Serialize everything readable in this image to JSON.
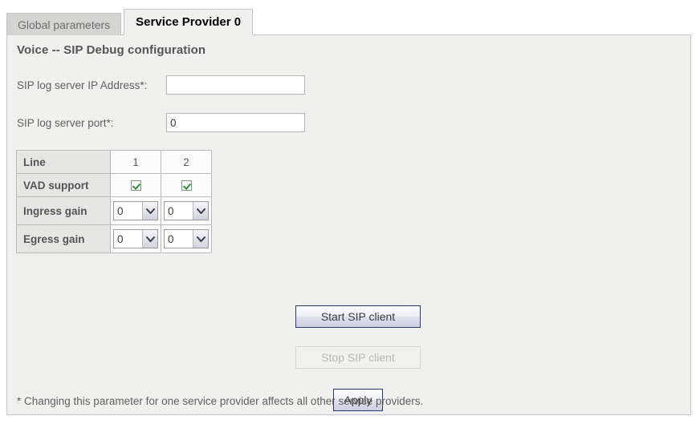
{
  "tabs": [
    {
      "label": "Global parameters",
      "active": false
    },
    {
      "label": "Service Provider 0",
      "active": true
    }
  ],
  "page": {
    "title": "Voice -- SIP Debug configuration",
    "footnote": "* Changing this parameter for one service provider affects all other service providers."
  },
  "fields": {
    "sip_log_server_ip": {
      "label": "SIP log server IP Address*:",
      "value": "",
      "placeholder": ""
    },
    "sip_log_server_port": {
      "label": "SIP log server port*:",
      "value": "0",
      "placeholder": ""
    }
  },
  "line_table": {
    "row_headers": [
      "Line",
      "VAD support",
      "Ingress gain",
      "Egress gain"
    ],
    "columns": [
      "1",
      "2"
    ],
    "vad_support": [
      true,
      true
    ],
    "ingress_gain": [
      "0",
      "0"
    ],
    "egress_gain": [
      "0",
      "0"
    ],
    "gain_options": [
      "0"
    ]
  },
  "buttons": {
    "start_sip_client": {
      "label": "Start SIP client",
      "enabled": true
    },
    "stop_sip_client": {
      "label": "Stop SIP client",
      "enabled": false
    },
    "apply": {
      "label": "Apply",
      "enabled": true
    }
  },
  "colors": {
    "panel_background": "#f0f0ee",
    "panel_border": "#c4c4c2",
    "inactive_tab": "#d4d4d2",
    "active_tab": "#f0f0ee",
    "button_focus_border": "#2b3a6b",
    "checkbox_check": "#2e8b3d",
    "text": "#5a5a5a"
  }
}
